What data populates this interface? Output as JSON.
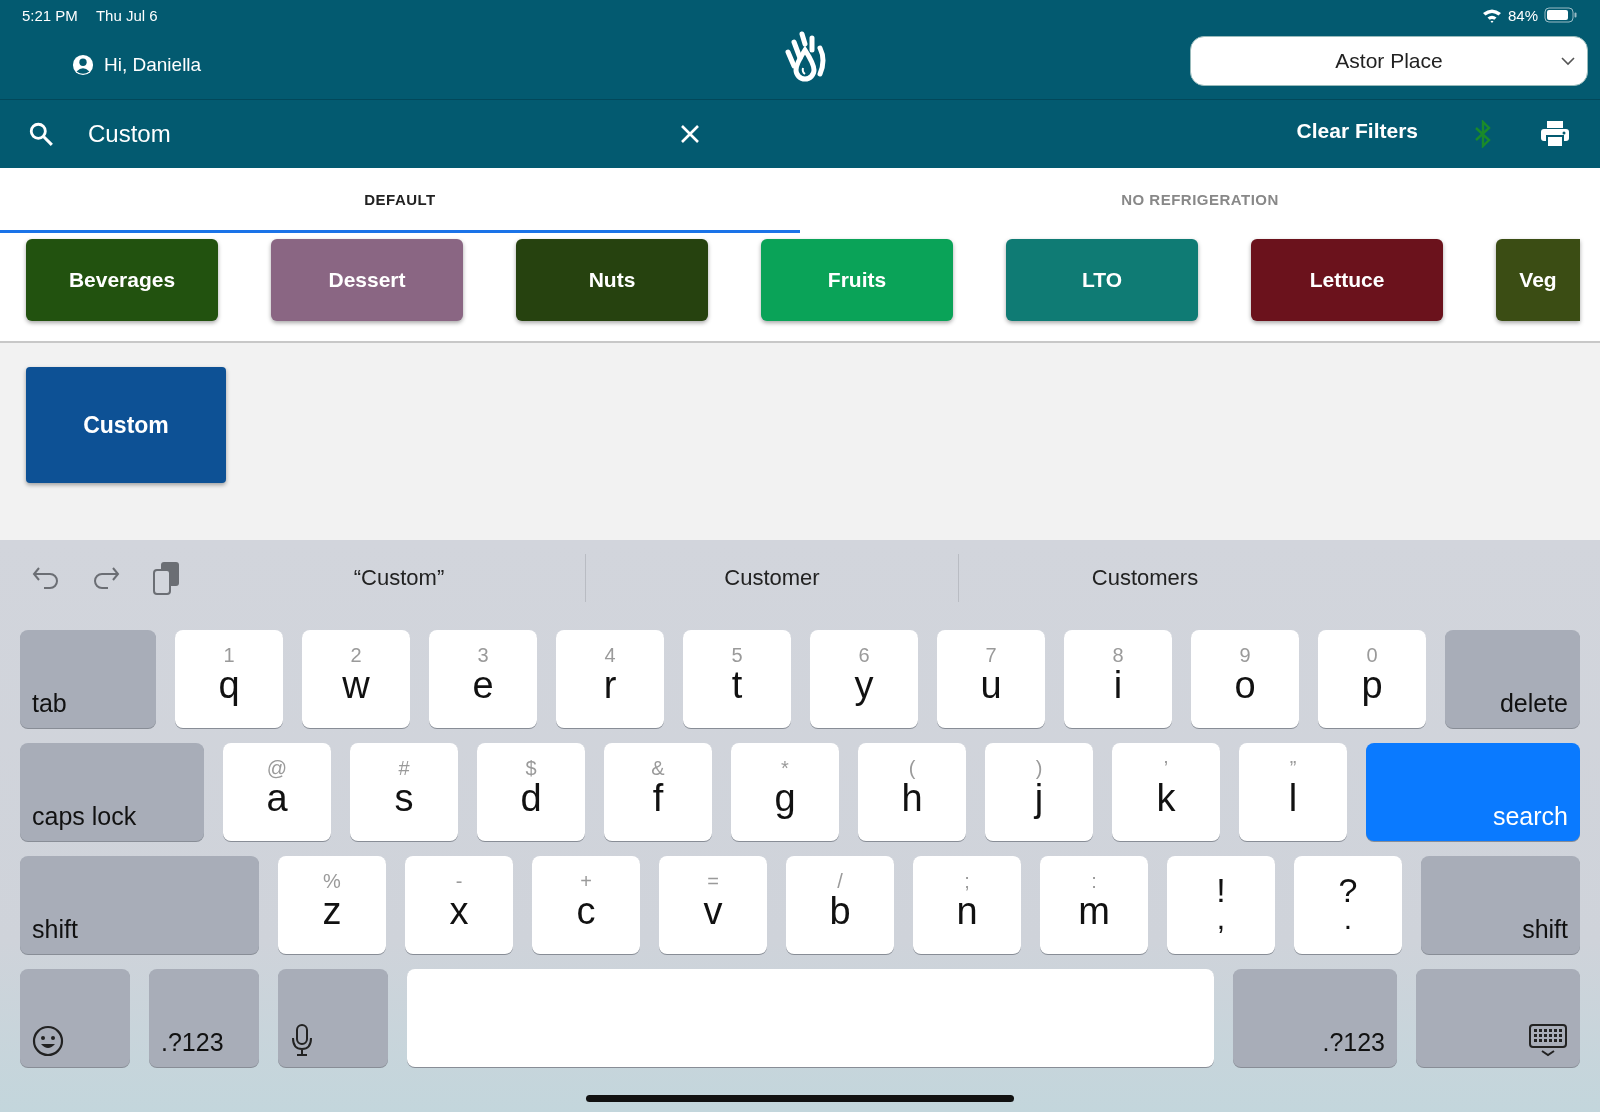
{
  "status_bar": {
    "time": "5:21 PM",
    "date": "Thu Jul 6",
    "battery": "84%"
  },
  "header": {
    "greeting": "Hi, Daniella",
    "location": "Astor Place"
  },
  "search": {
    "value": "Custom",
    "clear_filters": "Clear Filters"
  },
  "tabs": [
    {
      "label": "DEFAULT",
      "selected": true
    },
    {
      "label": "NO REFRIGERATION",
      "selected": false
    }
  ],
  "categories": [
    {
      "label": "Beverages",
      "color": "#22520f"
    },
    {
      "label": "Dessert",
      "color": "#8a6683"
    },
    {
      "label": "Nuts",
      "color": "#26420f"
    },
    {
      "label": "Fruits",
      "color": "#0aa358"
    },
    {
      "label": "LTO",
      "color": "#0f7b74"
    },
    {
      "label": "Lettuce",
      "color": "#6b121c"
    },
    {
      "label": "Veg",
      "color": "#3b4d14"
    }
  ],
  "results": [
    {
      "label": "Custom"
    }
  ],
  "keyboard": {
    "suggestions": [
      "“Custom”",
      "Customer",
      "Customers"
    ],
    "rows": [
      [
        {
          "kind": "leftkey",
          "label": "tab"
        },
        {
          "kind": "letter",
          "main": "q",
          "alt": "1"
        },
        {
          "kind": "letter",
          "main": "w",
          "alt": "2"
        },
        {
          "kind": "letter",
          "main": "e",
          "alt": "3"
        },
        {
          "kind": "letter",
          "main": "r",
          "alt": "4"
        },
        {
          "kind": "letter",
          "main": "t",
          "alt": "5"
        },
        {
          "kind": "letter",
          "main": "y",
          "alt": "6"
        },
        {
          "kind": "letter",
          "main": "u",
          "alt": "7"
        },
        {
          "kind": "letter",
          "main": "i",
          "alt": "8"
        },
        {
          "kind": "letter",
          "main": "o",
          "alt": "9"
        },
        {
          "kind": "letter",
          "main": "p",
          "alt": "0"
        },
        {
          "kind": "rightkey",
          "label": "delete"
        }
      ],
      [
        {
          "kind": "leftkey",
          "label": "caps lock"
        },
        {
          "kind": "letter",
          "main": "a",
          "alt": "@"
        },
        {
          "kind": "letter",
          "main": "s",
          "alt": "#"
        },
        {
          "kind": "letter",
          "main": "d",
          "alt": "$"
        },
        {
          "kind": "letter",
          "main": "f",
          "alt": "&"
        },
        {
          "kind": "letter",
          "main": "g",
          "alt": "*"
        },
        {
          "kind": "letter",
          "main": "h",
          "alt": "("
        },
        {
          "kind": "letter",
          "main": "j",
          "alt": ")"
        },
        {
          "kind": "letter",
          "main": "k",
          "alt": "’"
        },
        {
          "kind": "letter",
          "main": "l",
          "alt": "”"
        },
        {
          "kind": "action",
          "label": "search"
        }
      ],
      [
        {
          "kind": "leftkey",
          "label": "shift"
        },
        {
          "kind": "letter",
          "main": "z",
          "alt": "%"
        },
        {
          "kind": "letter",
          "main": "x",
          "alt": "-"
        },
        {
          "kind": "letter",
          "main": "c",
          "alt": "+"
        },
        {
          "kind": "letter",
          "main": "v",
          "alt": "="
        },
        {
          "kind": "letter",
          "main": "b",
          "alt": "/"
        },
        {
          "kind": "letter",
          "main": "n",
          "alt": ";"
        },
        {
          "kind": "letter",
          "main": "m",
          "alt": ":"
        },
        {
          "kind": "dual",
          "top": "!",
          "bottom": ","
        },
        {
          "kind": "dual",
          "top": "?",
          "bottom": "."
        },
        {
          "kind": "rightkey",
          "label": "shift"
        }
      ],
      [
        {
          "kind": "emoji"
        },
        {
          "kind": "leftkey",
          "label": ".?123"
        },
        {
          "kind": "mic"
        },
        {
          "kind": "space"
        },
        {
          "kind": "rightkey",
          "label": ".?123"
        },
        {
          "kind": "hide"
        }
      ]
    ]
  }
}
